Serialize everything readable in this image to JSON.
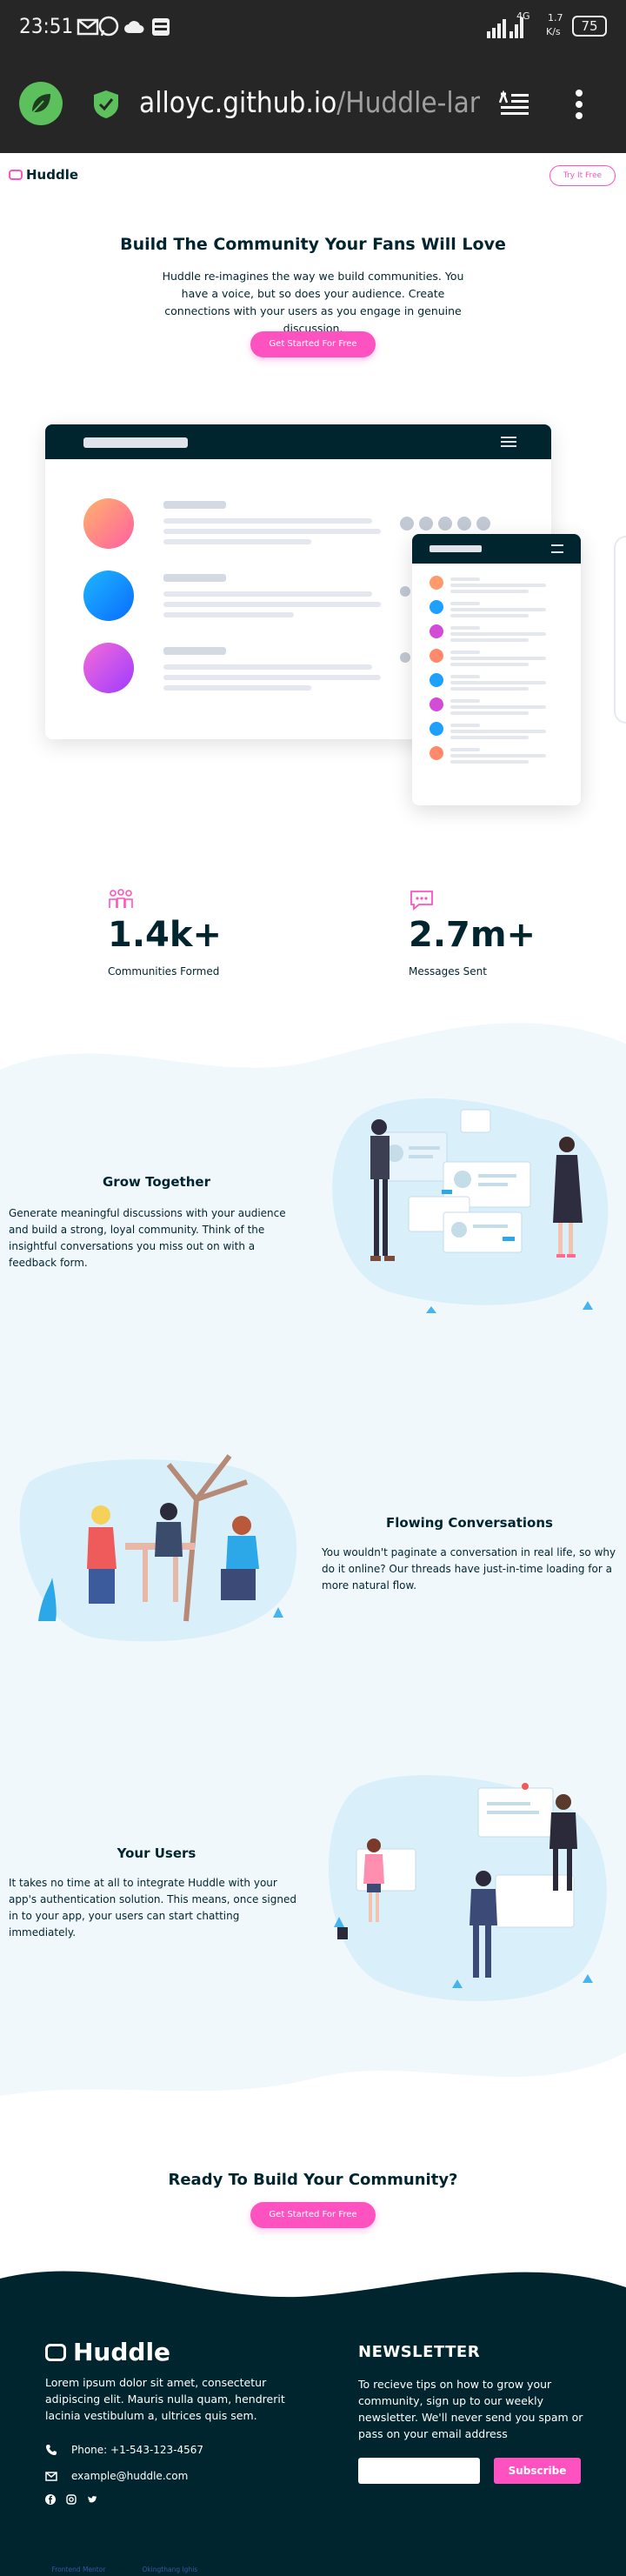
{
  "status_bar": {
    "time": "23:51",
    "network": "4G",
    "speed_value": "1.7",
    "speed_unit": "K/s",
    "battery": "75"
  },
  "browser": {
    "url_domain": "alloyc.github.io",
    "url_path": "/Huddle-landing-pa"
  },
  "nav": {
    "brand": "Huddle",
    "try_button": "Try It Free"
  },
  "hero": {
    "title": "Build The Community Your Fans Will Love",
    "text": "Huddle re-imagines the way we build communities. You have a voice, but so does your audience. Create connections with your users as you engage in genuine discussion.",
    "cta": "Get Started For Free"
  },
  "stats": [
    {
      "number": "1.4k+",
      "label": "Communities Formed",
      "icon": "communities-icon"
    },
    {
      "number": "2.7m+",
      "label": "Messages Sent",
      "icon": "messages-icon"
    }
  ],
  "features": [
    {
      "title": "Grow Together",
      "text": "Generate meaningful discussions with your audience and build a strong, loyal community. Think of the insightful conversations you miss out on with a feedback form."
    },
    {
      "title": "Flowing Conversations",
      "text": "You wouldn't paginate a conversation in real life, so why do it online? Our threads have just-in-time loading for a more natural flow."
    },
    {
      "title": "Your Users",
      "text": "It takes no time at all to integrate Huddle with your app's authentication solution. This means, once signed in to your app, your users can start chatting immediately."
    }
  ],
  "cta": {
    "title": "Ready To Build Your Community?",
    "button": "Get Started For Free"
  },
  "footer": {
    "brand": "Huddle",
    "description": "Lorem ipsum dolor sit amet, consectetur adipiscing elit. Mauris nulla quam, hendrerit lacinia vestibulum a, ultrices quis sem.",
    "phone": "Phone: +1-543-123-4567",
    "email": "example@huddle.com",
    "newsletter_title": "NEWSLETTER",
    "newsletter_text": "To recieve tips on how to grow your community, sign up to our weekly newsletter. We'll never send you spam or pass on your email address",
    "subscribe": "Subscribe",
    "email_value": ""
  },
  "attribution": {
    "prefix": "Challenge by",
    "fm": "Frontend Mentor",
    "middle": ". Coded by",
    "author": "Okingthang Ighis",
    "suffix": "."
  },
  "colors": {
    "dark": "#00252e",
    "pink": "#ff52c1",
    "wave": "#f0f8fc"
  }
}
